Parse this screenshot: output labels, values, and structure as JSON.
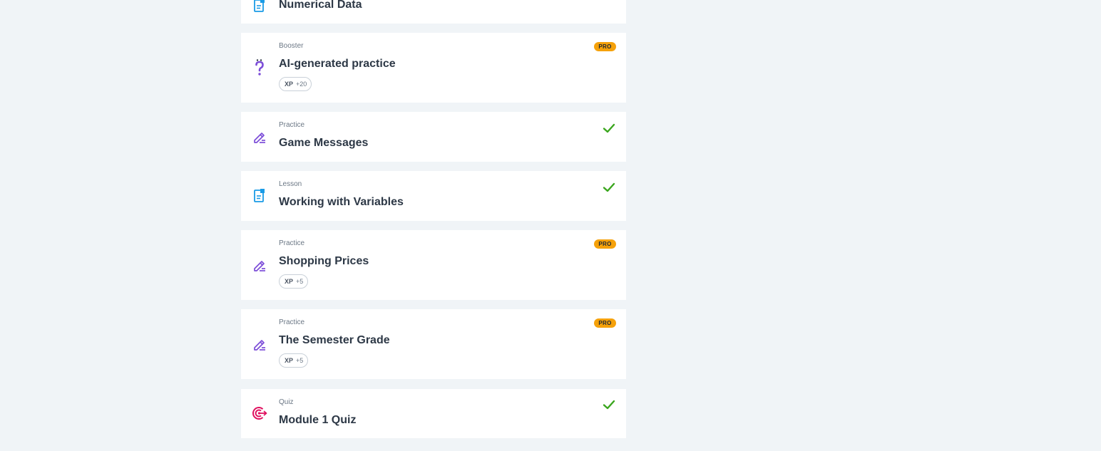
{
  "items": [
    {
      "type": "",
      "title": "Numerical Data",
      "icon": "lesson-document-icon"
    },
    {
      "type": "Booster",
      "title": "AI-generated practice",
      "badge": "PRO",
      "xp_label": "XP",
      "xp_value": "+20",
      "icon": "question-mark-icon"
    },
    {
      "type": "Practice",
      "title": "Game Messages",
      "completed": true,
      "icon": "pencil-edit-icon"
    },
    {
      "type": "Lesson",
      "title": "Working with Variables",
      "completed": true,
      "icon": "lesson-document-icon"
    },
    {
      "type": "Practice",
      "title": "Shopping Prices",
      "badge": "PRO",
      "xp_label": "XP",
      "xp_value": "+5",
      "icon": "pencil-edit-icon"
    },
    {
      "type": "Practice",
      "title": "The Semester Grade",
      "badge": "PRO",
      "xp_label": "XP",
      "xp_value": "+5",
      "icon": "pencil-edit-icon"
    },
    {
      "type": "Quiz",
      "title": "Module 1 Quiz",
      "completed": true,
      "icon": "target-quiz-icon"
    }
  ],
  "colors": {
    "page_background": "#f0f4f7",
    "card_background": "#ffffff",
    "lesson_icon": "#1a9be6",
    "practice_icon": "#7c4dd8",
    "quiz_icon": "#e0115f",
    "pro_badge": "#f5a10a",
    "check": "#3aa61d"
  }
}
